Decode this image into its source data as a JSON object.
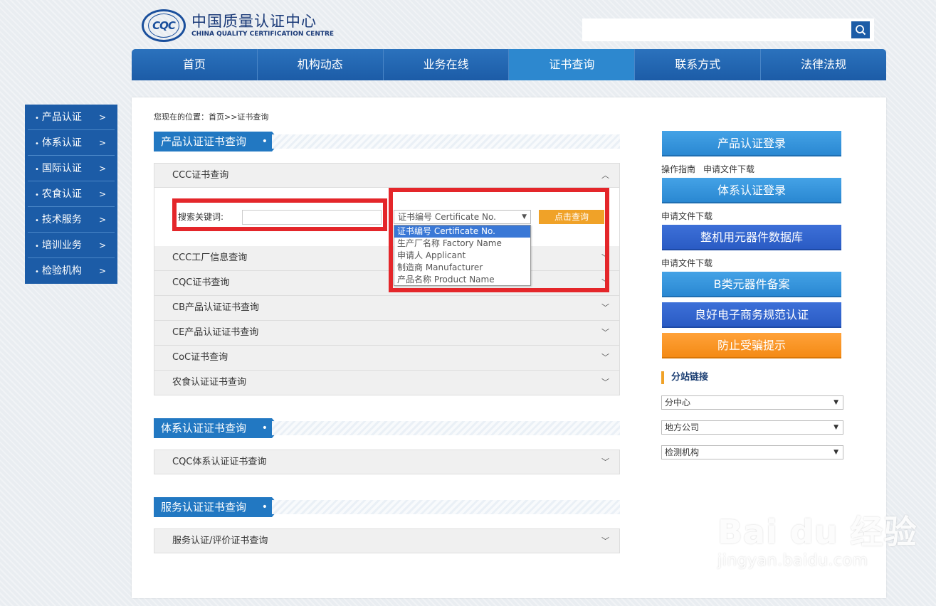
{
  "header": {
    "logo_mark": "CQC",
    "logo_cn": "中国质量认证中心",
    "logo_en": "CHINA QUALITY CERTIFICATION CENTRE",
    "search_placeholder": ""
  },
  "nav": {
    "items": [
      "首页",
      "机构动态",
      "业务在线",
      "证书查询",
      "联系方式",
      "法律法规"
    ],
    "active_index": 3
  },
  "left_menu": {
    "items": [
      "产品认证",
      "体系认证",
      "国际认证",
      "农食认证",
      "技术服务",
      "培训业务",
      "检验机构"
    ]
  },
  "breadcrumb": "您现在的位置：首页>>证书查询",
  "sections": {
    "product": {
      "title": "产品认证证书查询",
      "items": [
        "CCC证书查询",
        "CCC工厂信息查询",
        "CQC证书查询",
        "CB产品认证证书查询",
        "CE产品认证证书查询",
        "CoC证书查询",
        "农食认证证书查询"
      ]
    },
    "system": {
      "title": "体系认证证书查询",
      "items": [
        "CQC体系认证证书查询"
      ]
    },
    "service": {
      "title": "服务认证证书查询",
      "items": [
        "服务认证/评价证书查询"
      ]
    }
  },
  "ccc_form": {
    "keyword_label": "搜索关键词:",
    "keyword_value": "",
    "select_value": "证书编号 Certificate No.",
    "query_button": "点击查询",
    "options": [
      "证书编号 Certificate No.",
      "生产厂名称 Factory Name",
      "申请人 Applicant",
      "制造商 Manufacturer",
      "产品名称 Product Name"
    ],
    "selected_option_index": 0
  },
  "right": {
    "buttons": [
      "产品认证登录",
      "体系认证登录",
      "整机用元器件数据库",
      "B类元器件备案",
      "良好电子商务规范认证",
      "防止受骗提示"
    ],
    "links_1": [
      "操作指南",
      "申请文件下载"
    ],
    "links_2": [
      "申请文件下载"
    ],
    "links_3": [
      "申请文件下载"
    ],
    "branch_title": "分站链接",
    "selects": [
      "分中心",
      "地方公司",
      "检测机构"
    ]
  },
  "watermark": {
    "main": "Bai du 经验",
    "sub": "jingyan.baidu.com"
  },
  "colors": {
    "nav_blue": "#1c5ca7",
    "accent_orange": "#f0a228",
    "highlight_red": "#e4262a"
  }
}
